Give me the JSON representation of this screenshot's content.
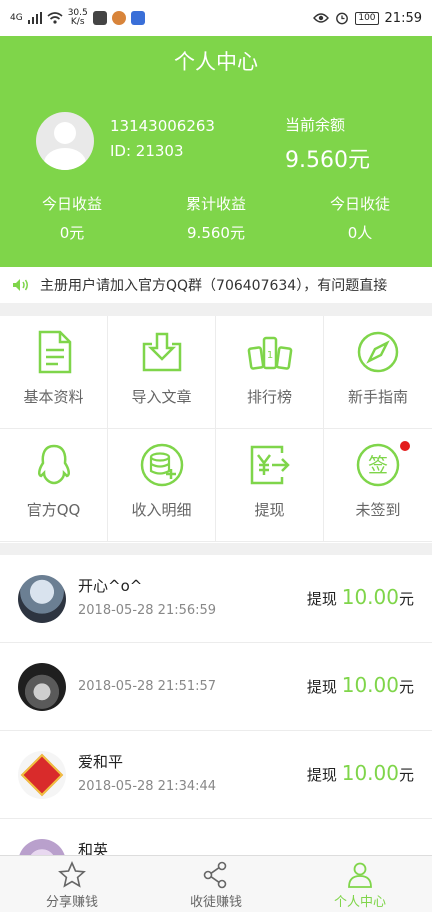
{
  "status_bar": {
    "signal": "4G",
    "speed_value": "30.5",
    "speed_unit": "K/s",
    "battery": "100",
    "time": "21:59"
  },
  "header": {
    "title": "个人中心",
    "phone": "13143006263",
    "user_id": "ID: 21303",
    "balance_label": "当前余额",
    "balance_value": "9.560元",
    "stats": [
      {
        "label": "今日收益",
        "value": "0元"
      },
      {
        "label": "累计收益",
        "value": "9.560元"
      },
      {
        "label": "今日收徒",
        "value": "0人"
      }
    ]
  },
  "notice": {
    "text": "主册用户请加入官方QQ群（706407634），有问题直接"
  },
  "menu": [
    {
      "label": "基本资料",
      "icon": "document-icon"
    },
    {
      "label": "导入文章",
      "icon": "import-icon"
    },
    {
      "label": "排行榜",
      "icon": "podium-icon"
    },
    {
      "label": "新手指南",
      "icon": "compass-icon"
    },
    {
      "label": "官方QQ",
      "icon": "qq-penguin-icon"
    },
    {
      "label": "收入明细",
      "icon": "coins-icon"
    },
    {
      "label": "提现",
      "icon": "yuan-withdraw-icon"
    },
    {
      "label": "未签到",
      "icon": "sign-in-icon",
      "badge_text": "签"
    }
  ],
  "withdrawals": [
    {
      "name": "开心^o^",
      "time": "2018-05-28 21:56:59",
      "prefix": "提现",
      "amount": "10.00",
      "unit": "元"
    },
    {
      "name": "",
      "time": "2018-05-28 21:51:57",
      "prefix": "提现",
      "amount": "10.00",
      "unit": "元"
    },
    {
      "name": "爱和平",
      "time": "2018-05-28 21:34:44",
      "prefix": "提现",
      "amount": "10.00",
      "unit": "元"
    },
    {
      "name": "和英",
      "time": "",
      "prefix": "",
      "amount": "",
      "unit": ""
    }
  ],
  "tabs": [
    {
      "label": "分享赚钱",
      "icon": "star-icon"
    },
    {
      "label": "收徒赚钱",
      "icon": "share-icon"
    },
    {
      "label": "个人中心",
      "icon": "person-icon"
    }
  ],
  "colors": {
    "accent": "#7fd54a",
    "badge_dot": "#e31b1b"
  }
}
